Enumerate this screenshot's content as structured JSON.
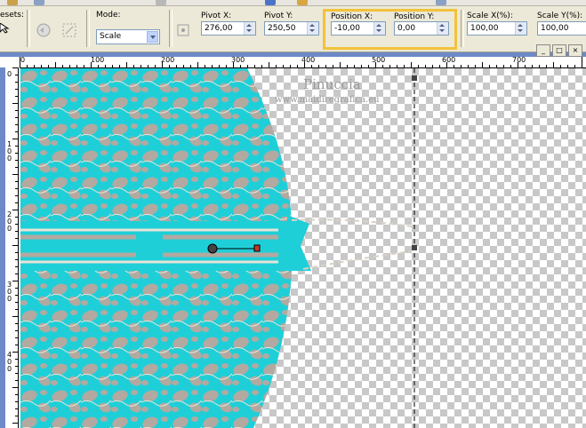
{
  "app": {
    "accent_canvas": "#1fcfd8",
    "pattern_color": "#b3a9a0"
  },
  "toolbar": {
    "presets_label": "esets:",
    "mode_label": "Mode:",
    "mode_value": "Scale",
    "pivot_x_label": "Pivot X:",
    "pivot_x_value": "276,00",
    "pivot_y_label": "Pivot Y:",
    "pivot_y_value": "250,50",
    "position_x_label": "Position X:",
    "position_x_value": "-10,00",
    "position_y_label": "Position Y:",
    "position_y_value": "0,00",
    "scale_x_label": "Scale X(%):",
    "scale_x_value": "100,00",
    "scale_y_label": "Scale Y(%):",
    "scale_y_value": "100,00"
  },
  "window": {
    "close": "×",
    "restore": "□",
    "minimize": "_"
  },
  "ruler_top": [
    "0",
    "100",
    "200",
    "300",
    "400",
    "500",
    "600",
    "700"
  ],
  "ruler_left": [
    {
      "digits": "0"
    },
    {
      "digits": "100"
    },
    {
      "digits": "200"
    },
    {
      "digits": "300"
    },
    {
      "digits": "400"
    }
  ],
  "watermark": {
    "line1": "Pinuccia",
    "line2": "www.maidiregrafica.eu"
  }
}
